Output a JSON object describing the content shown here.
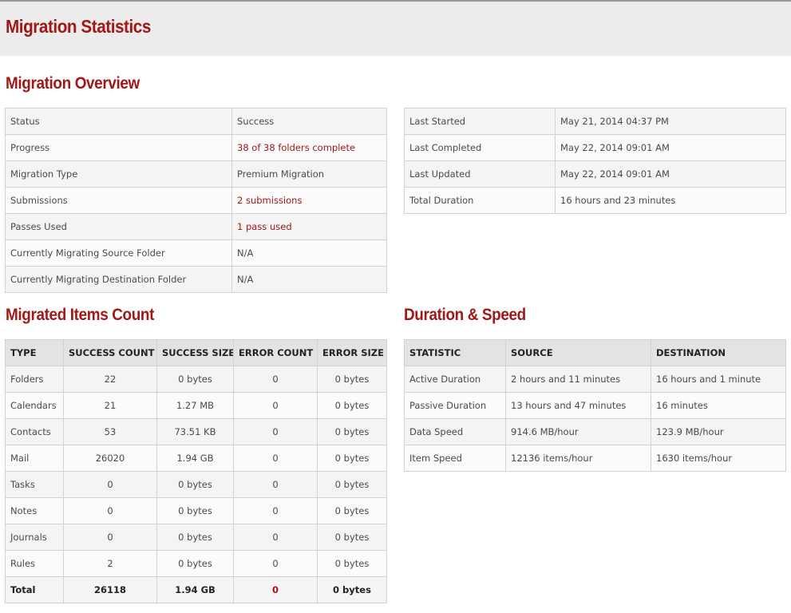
{
  "page": {
    "title": "Migration Statistics"
  },
  "overview": {
    "title": "Migration Overview",
    "left_rows": [
      {
        "label": "Status",
        "value": "Success"
      },
      {
        "label": "Progress",
        "value": "38 of 38 folders complete"
      },
      {
        "label": "Migration Type",
        "value": "Premium Migration"
      },
      {
        "label": "Submissions",
        "value": "2 submissions"
      },
      {
        "label": "Passes Used",
        "value": "1 pass used"
      },
      {
        "label": "Currently Migrating Source Folder",
        "value": "N/A"
      },
      {
        "label": "Currently Migrating Destination Folder",
        "value": "N/A"
      }
    ],
    "right_rows": [
      {
        "label": "Last Started",
        "value": "May 21, 2014 04:37 PM"
      },
      {
        "label": "Last Completed",
        "value": "May 22, 2014 09:01 AM"
      },
      {
        "label": "Last Updated",
        "value": "May 22, 2014 09:01 AM"
      },
      {
        "label": "Total Duration",
        "value": "16 hours and 23 minutes"
      }
    ]
  },
  "items": {
    "title": "Migrated Items Count",
    "headers": [
      "TYPE",
      "SUCCESS COUNT",
      "SUCCESS SIZE",
      "ERROR COUNT",
      "ERROR SIZE"
    ],
    "rows": [
      [
        "Folders",
        "22",
        "0 bytes",
        "0",
        "0 bytes"
      ],
      [
        "Calendars",
        "21",
        "1.27 MB",
        "0",
        "0 bytes"
      ],
      [
        "Contacts",
        "53",
        "73.51 KB",
        "0",
        "0 bytes"
      ],
      [
        "Mail",
        "26020",
        "1.94 GB",
        "0",
        "0 bytes"
      ],
      [
        "Tasks",
        "0",
        "0 bytes",
        "0",
        "0 bytes"
      ],
      [
        "Notes",
        "0",
        "0 bytes",
        "0",
        "0 bytes"
      ],
      [
        "Journals",
        "0",
        "0 bytes",
        "0",
        "0 bytes"
      ],
      [
        "Rules",
        "2",
        "0 bytes",
        "0",
        "0 bytes"
      ]
    ],
    "total": [
      "Total",
      "26118",
      "1.94 GB",
      "0",
      "0 bytes"
    ]
  },
  "speed": {
    "title": "Duration & Speed",
    "headers": [
      "STATISTIC",
      "SOURCE",
      "DESTINATION"
    ],
    "rows": [
      [
        "Active Duration",
        "2 hours and 11 minutes",
        "16 hours and 1 minute"
      ],
      [
        "Passive Duration",
        "13 hours and 47 minutes",
        "16 minutes"
      ],
      [
        "Data Speed",
        "914.6 MB/hour",
        "123.9 MB/hour"
      ],
      [
        "Item Speed",
        "12136 items/hour",
        "1630 items/hour"
      ]
    ]
  },
  "colors": {
    "accent": "#a01818",
    "header_bg": "#ececec"
  }
}
